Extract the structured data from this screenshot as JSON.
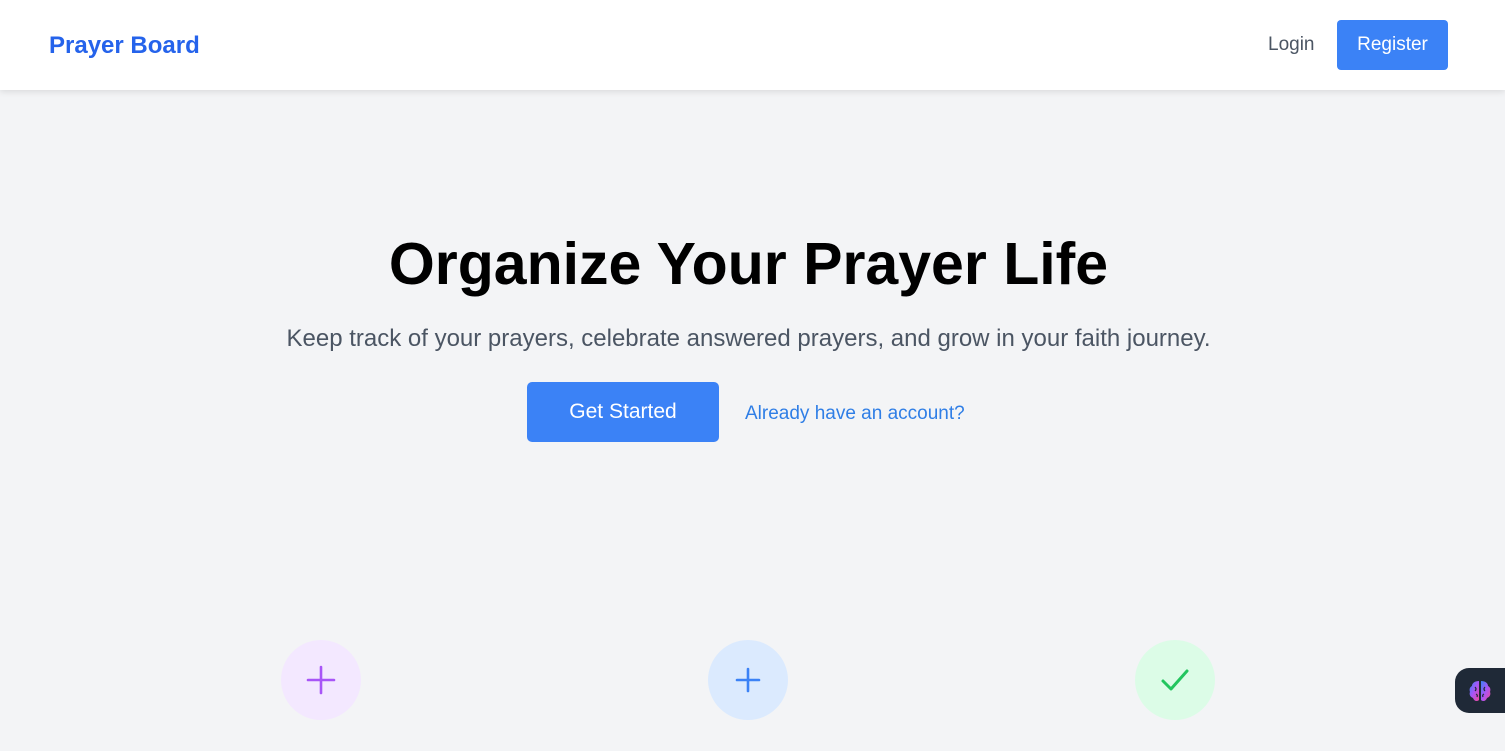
{
  "navbar": {
    "brand": "Prayer Board",
    "login_label": "Login",
    "register_label": "Register"
  },
  "hero": {
    "title": "Organize Your Prayer Life",
    "subtitle": "Keep track of your prayers, celebrate answered prayers, and grow in your faith journey.",
    "primary_cta": "Get Started",
    "secondary_cta": "Already have an account?"
  },
  "features": [
    {
      "icon": "plus-icon",
      "icon_color": "#a855f7",
      "bg_color": "#f3e8ff"
    },
    {
      "icon": "plus-icon",
      "icon_color": "#3b82f6",
      "bg_color": "#dbeafe"
    },
    {
      "icon": "check-icon",
      "icon_color": "#22c55e",
      "bg_color": "#dcfce7"
    }
  ],
  "widget": {
    "icon": "brain-icon"
  },
  "colors": {
    "brand": "#2563eb",
    "accent": "#3b82f6",
    "background": "#f3f4f6"
  }
}
